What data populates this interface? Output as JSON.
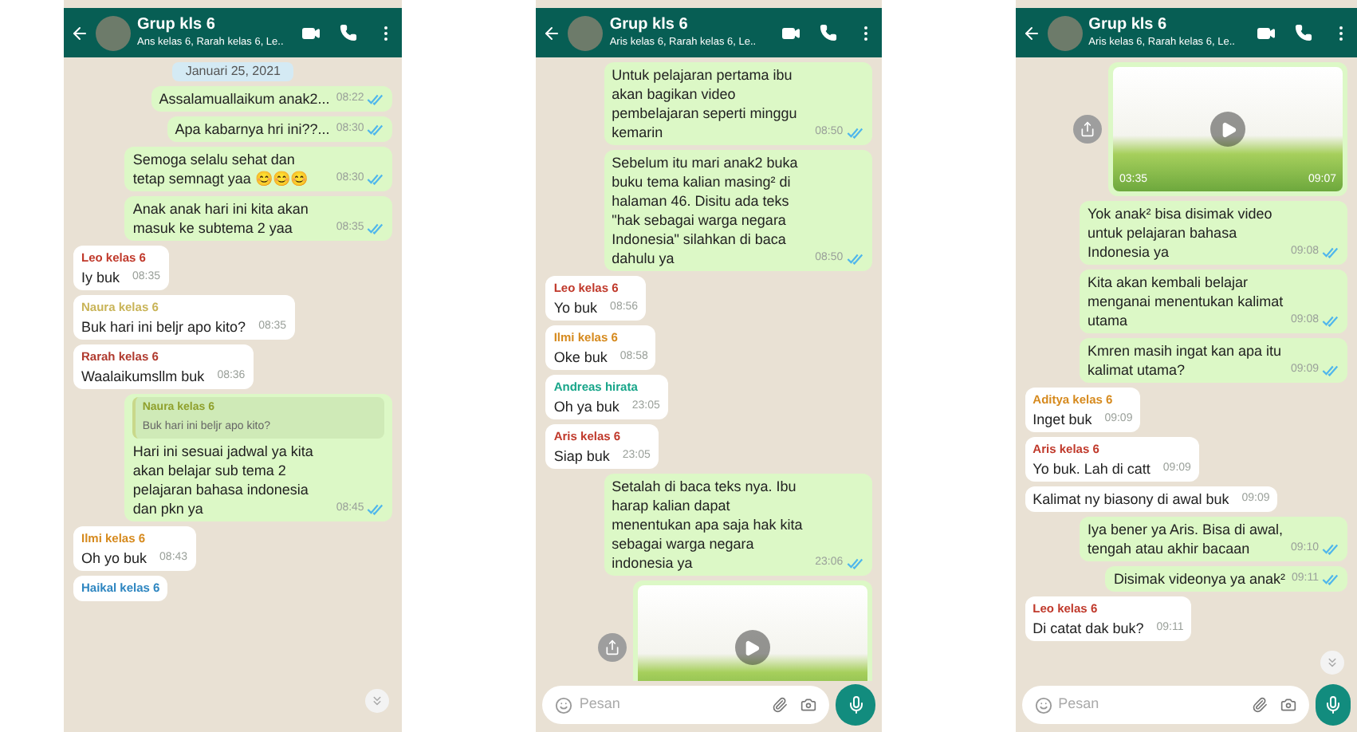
{
  "phones": [
    {
      "header": {
        "title": "Grup kls 6",
        "subtitle": "Ans kelas 6, Rarah kelas 6, Le.."
      },
      "scroll_button": true,
      "messages": [
        {
          "kind": "date",
          "text": "Januari 25, 2021"
        },
        {
          "kind": "out",
          "text": "Assalamuallaikum anak2...",
          "time": "08:22",
          "read": true
        },
        {
          "kind": "out",
          "text": "Apa kabarnya hri ini??...",
          "time": "08:30",
          "read": true
        },
        {
          "kind": "out",
          "text": "Semoga selalu sehat dan tetap semnagt yaa 😊😊😊",
          "time": "08:30",
          "read": true
        },
        {
          "kind": "out",
          "text": "Anak anak hari ini kita akan masuk ke subtema 2 yaa",
          "time": "08:35",
          "read": true
        },
        {
          "kind": "in",
          "sender": "Leo kelas 6",
          "color": "#c0392b",
          "text": "Iy buk",
          "time": "08:35"
        },
        {
          "kind": "in",
          "sender": "Naura kelas 6",
          "color": "#c9b458",
          "text": "Buk hari ini beljr apo kito?",
          "time": "08:35"
        },
        {
          "kind": "in",
          "sender": "Rarah kelas 6",
          "color": "#b03a2e",
          "text": "Waalaikumsllm buk",
          "time": "08:36"
        },
        {
          "kind": "out",
          "quote": {
            "sender": "Naura kelas 6",
            "text": "Buk hari ini beljr apo kito?"
          },
          "text": "Hari ini sesuai jadwal ya kita akan belajar sub tema 2 pelajaran bahasa indonesia dan pkn ya",
          "time": "08:45",
          "read": true
        },
        {
          "kind": "in",
          "sender": "Ilmi kelas 6",
          "color": "#d68a1e",
          "text": "Oh yo buk",
          "time": "08:43"
        },
        {
          "kind": "in",
          "sender": "Haikal kelas 6",
          "color": "#2e86c1"
        }
      ]
    },
    {
      "header": {
        "title": "Grup kls 6",
        "subtitle": "Aris kelas 6, Rarah kelas 6, Le.."
      },
      "scroll_button": false,
      "input": {
        "placeholder": "Pesan"
      },
      "messages": [
        {
          "kind": "out",
          "text": "Untuk pelajaran pertama ibu akan bagikan video pembelajaran seperti minggu kemarin",
          "time": "08:50",
          "read": true
        },
        {
          "kind": "out",
          "text": "Sebelum itu mari anak2 buka buku tema kalian masing² di halaman 46. Disitu ada teks \"hak sebagai warga negara Indonesia\" silahkan di baca dahulu ya",
          "time": "08:50",
          "read": true
        },
        {
          "kind": "in",
          "sender": "Leo kelas 6",
          "color": "#c0392b",
          "text": "Yo buk",
          "time": "08:56"
        },
        {
          "kind": "in",
          "sender": "Ilmi kelas 6",
          "color": "#d68a1e",
          "text": "Oke buk",
          "time": "08:58"
        },
        {
          "kind": "in",
          "sender": "Andreas hirata",
          "color": "#17a589",
          "text": "Oh ya buk",
          "time": "23:05"
        },
        {
          "kind": "in",
          "sender": "Aris kelas 6",
          "color": "#c0392b",
          "text": "Siap buk",
          "time": "23:05"
        },
        {
          "kind": "out",
          "text": "Setalah di baca teks nya.  Ibu harap kalian dapat menentukan apa saja hak kita sebagai warga negara indonesia ya",
          "time": "23:06",
          "read": true
        },
        {
          "kind": "media"
        }
      ]
    },
    {
      "header": {
        "title": "Grup kls 6",
        "subtitle": "Aris kelas 6, Rarah kelas 6, Le.."
      },
      "scroll_button": true,
      "input": {
        "placeholder": "Pesan"
      },
      "messages": [
        {
          "kind": "media",
          "duration": "03:35",
          "time": "09:07"
        },
        {
          "kind": "out",
          "text": "Yok anak² bisa disimak video untuk pelajaran bahasa Indonesia ya",
          "time": "09:08",
          "read": true
        },
        {
          "kind": "out",
          "text": "Kita akan kembali belajar  menganai menentukan kalimat utama",
          "time": "09:08",
          "read": true
        },
        {
          "kind": "out",
          "text": "Kmren masih ingat kan apa itu kalimat utama?",
          "time": "09:09",
          "read": true
        },
        {
          "kind": "in",
          "sender": "Aditya kelas 6",
          "color": "#d68a1e",
          "text": "Inget buk",
          "time": "09:09"
        },
        {
          "kind": "in",
          "sender": "Aris kelas 6",
          "color": "#c0392b",
          "text": "Yo buk. Lah di catt",
          "time": "09:09"
        },
        {
          "kind": "in",
          "text": "Kalimat ny biasony di awal buk",
          "time": "09:09"
        },
        {
          "kind": "out",
          "text": "Iya bener ya Aris. Bisa di awal, tengah atau akhir bacaan",
          "time": "09:10",
          "read": true
        },
        {
          "kind": "out",
          "text": "Disimak videonya ya anak²",
          "time": "09:11",
          "read": true
        },
        {
          "kind": "in",
          "sender": "Leo kelas 6",
          "color": "#c0392b",
          "text": "Di catat dak buk?",
          "time": "09:11"
        }
      ]
    }
  ]
}
